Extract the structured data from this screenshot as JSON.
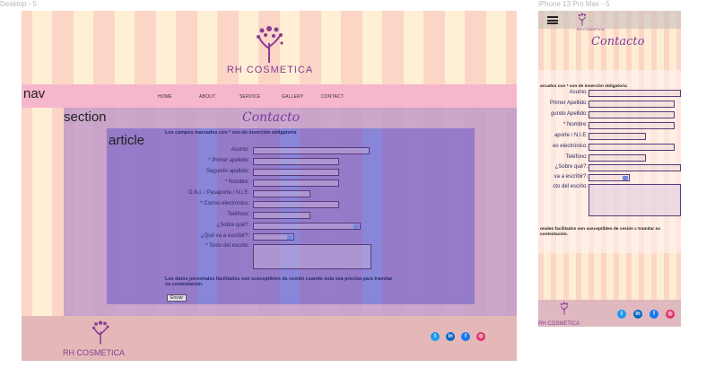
{
  "frames": {
    "desktop_label": "Desktop - 5",
    "phone_label": "iPhone 13 Pro Max - 5"
  },
  "brand": {
    "name": "RH COSMETICA"
  },
  "layout_labels": {
    "nav": "nav",
    "section": "section",
    "article": "article"
  },
  "nav": {
    "items": [
      "HOME",
      "ABOUT",
      "SERVICE",
      "GALLERY",
      "CONTACT"
    ]
  },
  "contact": {
    "title": "Contacto",
    "required_note": "Los campos marcados con * son de inserción obligatoria",
    "fields": [
      {
        "label": "Asunto:"
      },
      {
        "label": "* Primer apellido:"
      },
      {
        "label": "Segundo apellido:"
      },
      {
        "label": "* Nombre:"
      },
      {
        "label": "D.N.I. / Pasaporte / N.I.E:"
      },
      {
        "label": "* Correo electrónico:"
      },
      {
        "label": "Teléfono:"
      },
      {
        "label": "¿Sobre qué?:"
      },
      {
        "label": "¿Qué va a escribir?:"
      },
      {
        "label": "* Texto del escrito:"
      }
    ],
    "privacy_note": "Los datos personales facilitados son susceptibles de cesión cuando ésta sea precisa para tramitar su contestación.",
    "send_label": "Enviar"
  },
  "phone": {
    "required_note": "arcados con * son de inserción obligatoria",
    "fields": [
      {
        "label": "Asunto:"
      },
      {
        "label": "Primer Apellido:"
      },
      {
        "label": "gundo Apellido:"
      },
      {
        "label": "* Nombre:"
      },
      {
        "label": "aporte / N.I.E:"
      },
      {
        "label": "eo electrónico:"
      },
      {
        "label": "Teléfono:"
      },
      {
        "label": "¿Sobre qué?:"
      },
      {
        "label": "va a escribir?:"
      },
      {
        "label": "cto del escrito:"
      }
    ],
    "privacy_note": "onales facilitados son susceptibles de cesión c tramitar su contestación."
  },
  "social": [
    {
      "name": "twitter-icon",
      "glyph": "t",
      "color": "#1d9bf0"
    },
    {
      "name": "linkedin-icon",
      "glyph": "in",
      "color": "#0a66c2"
    },
    {
      "name": "facebook-icon",
      "glyph": "f",
      "color": "#1877f2"
    },
    {
      "name": "instagram-icon",
      "glyph": "◎",
      "color": "#e1306c"
    }
  ],
  "colors": {
    "accent": "#7d3aa0",
    "nav_bg": "#f6b6cb",
    "footer_bg": "#e4b8b8"
  }
}
